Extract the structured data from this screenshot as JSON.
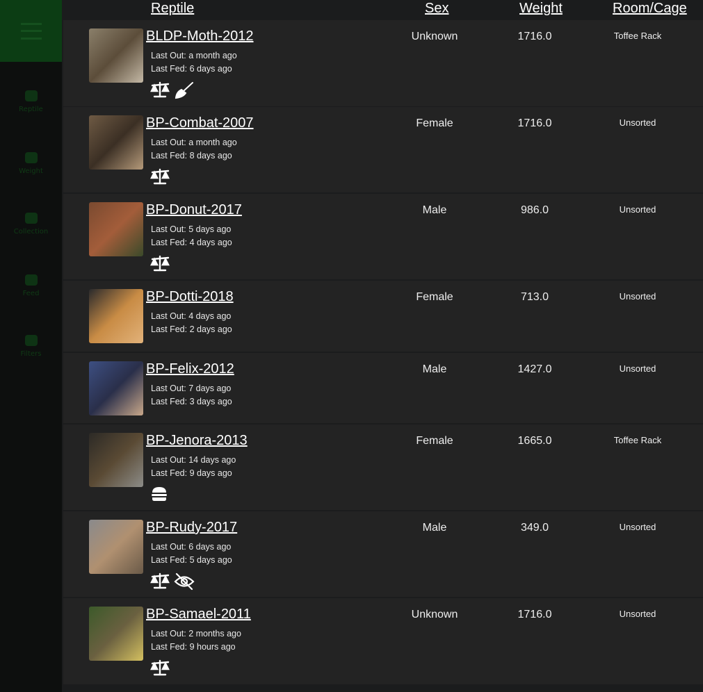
{
  "sidebar": {
    "items": [
      {
        "label": "Reptile",
        "icon": "reptile-icon"
      },
      {
        "label": "Weight",
        "icon": "scale-icon"
      },
      {
        "label": "Collection",
        "icon": "collection-icon"
      },
      {
        "label": "Feed",
        "icon": "feed-icon"
      },
      {
        "label": "Filters",
        "icon": "filter-icon"
      }
    ]
  },
  "table": {
    "headers": {
      "reptile": "Reptile",
      "sex": "Sex",
      "weight": "Weight",
      "room": "Room/Cage"
    },
    "rows": [
      {
        "name": "BLDP-Moth-2012",
        "last_out": "Last Out: a month ago",
        "last_fed": "Last Fed: 6 days ago",
        "sex": "Unknown",
        "weight": "1716.0",
        "room": "Toffee Rack",
        "icons": [
          "scale-icon",
          "broom-icon"
        ],
        "thumb_colors": [
          "#8a7f6a",
          "#5c4d3a",
          "#c4b9a6"
        ]
      },
      {
        "name": "BP-Combat-2007",
        "last_out": "Last Out: a month ago",
        "last_fed": "Last Fed: 8 days ago",
        "sex": "Female",
        "weight": "1716.0",
        "room": "Unsorted",
        "icons": [
          "scale-icon"
        ],
        "thumb_colors": [
          "#6e5a44",
          "#3b2f24",
          "#b59a7a"
        ]
      },
      {
        "name": "BP-Donut-2017",
        "last_out": "Last Out: 5 days ago",
        "last_fed": "Last Fed: 4 days ago",
        "sex": "Male",
        "weight": "986.0",
        "room": "Unsorted",
        "icons": [
          "scale-icon"
        ],
        "thumb_colors": [
          "#7a4a30",
          "#a35d3a",
          "#3a4a2a"
        ]
      },
      {
        "name": "BP-Dotti-2018",
        "last_out": "Last Out: 4 days ago",
        "last_fed": "Last Fed: 2 days ago",
        "sex": "Female",
        "weight": "713.0",
        "room": "Unsorted",
        "icons": [],
        "thumb_colors": [
          "#2a2a2c",
          "#c98c45",
          "#e2b27a"
        ]
      },
      {
        "name": "BP-Felix-2012",
        "last_out": "Last Out: 7 days ago",
        "last_fed": "Last Fed: 3 days ago",
        "sex": "Male",
        "weight": "1427.0",
        "room": "Unsorted",
        "icons": [],
        "thumb_colors": [
          "#3d4f82",
          "#2a2f4a",
          "#c9a88a"
        ]
      },
      {
        "name": "BP-Jenora-2013",
        "last_out": "Last Out: 14 days ago",
        "last_fed": "Last Fed: 9 days ago",
        "sex": "Female",
        "weight": "1665.0",
        "room": "Toffee Rack",
        "icons": [
          "burger-icon"
        ],
        "thumb_colors": [
          "#2c2a26",
          "#5a4a34",
          "#8c8c88"
        ]
      },
      {
        "name": "BP-Rudy-2017",
        "last_out": "Last Out: 6 days ago",
        "last_fed": "Last Fed: 5 days ago",
        "sex": "Male",
        "weight": "349.0",
        "room": "Unsorted",
        "icons": [
          "scale-icon",
          "eye-slash-icon"
        ],
        "thumb_colors": [
          "#8a8a8c",
          "#b09070",
          "#6a5a48"
        ]
      },
      {
        "name": "BP-Samael-2011",
        "last_out": "Last Out: 2 months ago",
        "last_fed": "Last Fed: 9 hours ago",
        "sex": "Unknown",
        "weight": "1716.0",
        "room": "Unsorted",
        "icons": [
          "scale-icon"
        ],
        "thumb_colors": [
          "#3c5a2a",
          "#6a6040",
          "#d4c060"
        ]
      }
    ]
  }
}
